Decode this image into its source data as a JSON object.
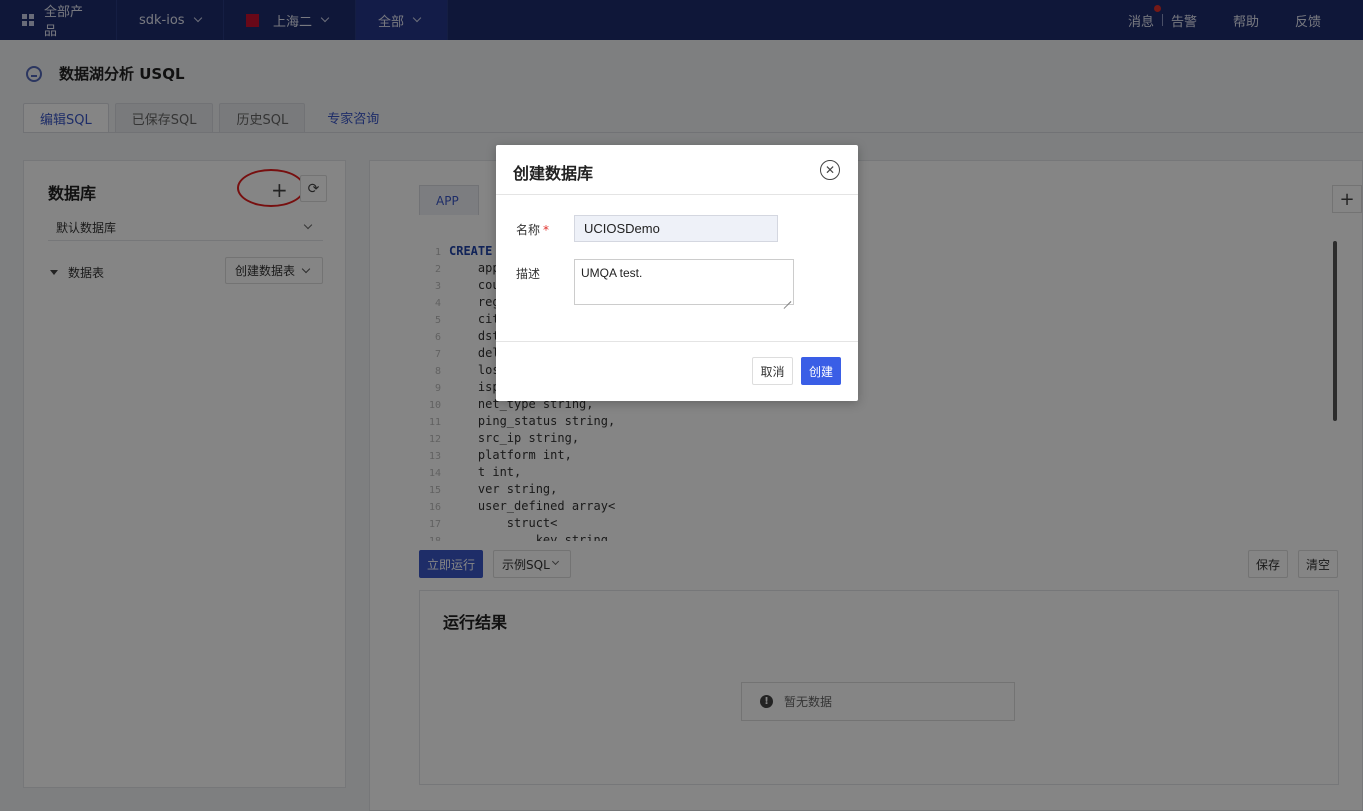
{
  "topbar": {
    "all_products": "全部产品",
    "project": "sdk-ios",
    "region": "上海二",
    "zone": "全部",
    "links": {
      "messages": "消息",
      "alerts": "告警",
      "help": "帮助",
      "feedback": "反馈"
    }
  },
  "page": {
    "title": "数据湖分析 USQL"
  },
  "tabs": [
    {
      "label": "编辑SQL"
    },
    {
      "label": "已保存SQL"
    },
    {
      "label": "历史SQL"
    },
    {
      "label": "专家咨询"
    }
  ],
  "left_panel": {
    "title": "数据库",
    "db_select": "默认数据库",
    "tables_label": "数据表",
    "create_table": "创建数据表",
    "add_symbol": "+",
    "refresh_symbol": "⟳"
  },
  "editor": {
    "tab": "APP",
    "add_tab_symbol": "+",
    "lines": [
      {
        "n": "1",
        "text": "CREATE "
      },
      {
        "n": "2",
        "text": "    app"
      },
      {
        "n": "3",
        "text": "    cou"
      },
      {
        "n": "4",
        "text": "    reg"
      },
      {
        "n": "5",
        "text": "    cit"
      },
      {
        "n": "6",
        "text": "    dst"
      },
      {
        "n": "7",
        "text": "    del"
      },
      {
        "n": "8",
        "text": "    los"
      },
      {
        "n": "9",
        "text": "    isp"
      },
      {
        "n": "10",
        "text": "    net_type string,"
      },
      {
        "n": "11",
        "text": "    ping_status string,"
      },
      {
        "n": "12",
        "text": "    src_ip string,"
      },
      {
        "n": "13",
        "text": "    platform int,"
      },
      {
        "n": "14",
        "text": "    t int,"
      },
      {
        "n": "15",
        "text": "    ver string,"
      },
      {
        "n": "16",
        "text": "    user_defined array<"
      },
      {
        "n": "17",
        "text": "        struct<"
      },
      {
        "n": "18",
        "text": "            key string,"
      }
    ]
  },
  "actions": {
    "run": "立即运行",
    "sample": "示例SQL",
    "save": "保存",
    "clear": "清空"
  },
  "result": {
    "title": "运行结果",
    "empty": "暂无数据",
    "info_symbol": "!"
  },
  "modal": {
    "title": "创建数据库",
    "close_symbol": "✕",
    "name_label": "名称",
    "required_mark": "*",
    "name_value": "UCIOSDemo",
    "desc_label": "描述",
    "desc_value": "UMQA test.",
    "cancel": "取消",
    "create": "创建"
  }
}
